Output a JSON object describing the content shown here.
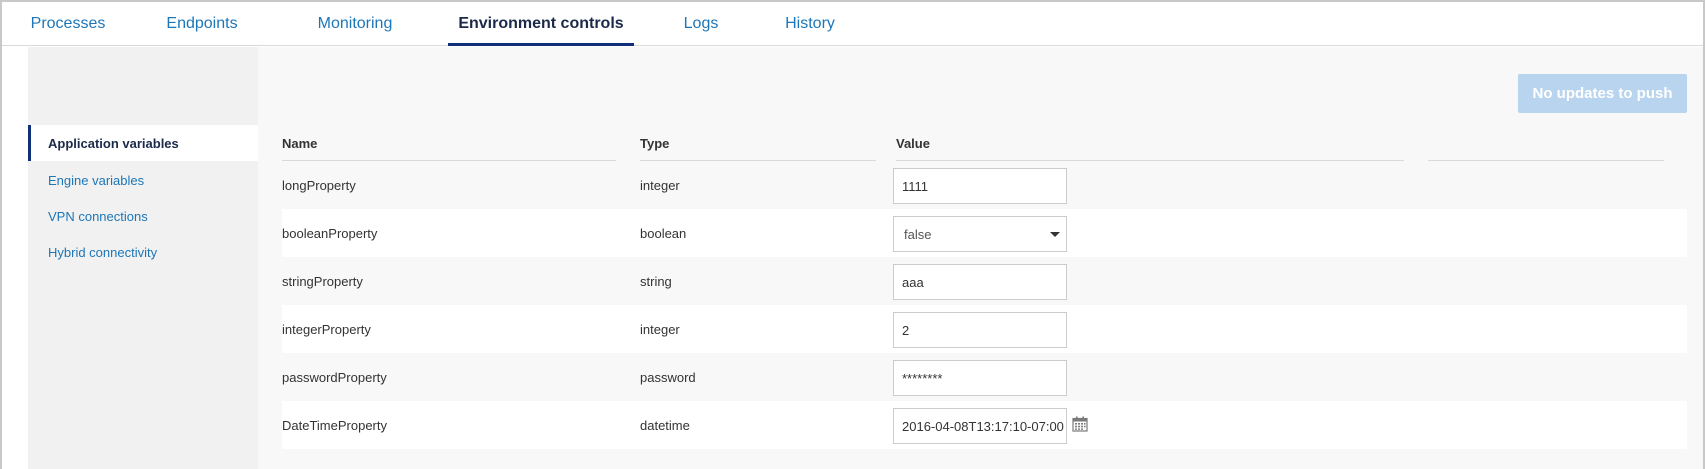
{
  "tabs": [
    {
      "label": "Processes",
      "active": false
    },
    {
      "label": "Endpoints",
      "active": false
    },
    {
      "label": "Monitoring",
      "active": false
    },
    {
      "label": "Environment controls",
      "active": true
    },
    {
      "label": "Logs",
      "active": false
    },
    {
      "label": "History",
      "active": false
    }
  ],
  "sidebar": {
    "items": [
      {
        "label": "Application variables",
        "active": true
      },
      {
        "label": "Engine variables",
        "active": false
      },
      {
        "label": "VPN connections",
        "active": false
      },
      {
        "label": "Hybrid connectivity",
        "active": false
      }
    ]
  },
  "toolbar": {
    "push_label": "No updates to push",
    "push_enabled": false
  },
  "table": {
    "columns": [
      "Name",
      "Type",
      "Value"
    ],
    "rows": [
      {
        "name": "longProperty",
        "type": "integer",
        "value": "1111",
        "control": "input"
      },
      {
        "name": "booleanProperty",
        "type": "boolean",
        "value": "false",
        "control": "select"
      },
      {
        "name": "stringProperty",
        "type": "string",
        "value": "aaa",
        "control": "input"
      },
      {
        "name": "integerProperty",
        "type": "integer",
        "value": "2",
        "control": "input"
      },
      {
        "name": "passwordProperty",
        "type": "password",
        "value": "********",
        "control": "password"
      },
      {
        "name": "DateTimeProperty",
        "type": "datetime",
        "value": "2016-04-08T13:17:10-07:00",
        "control": "datetime"
      }
    ]
  },
  "icons": {
    "select_caret": "chevron-down-icon",
    "date_picker": "calendar-icon"
  },
  "colors": {
    "link": "#1d76b8",
    "active_indicator": "#0f2f78",
    "disabled_button": "#b9d4ee"
  }
}
